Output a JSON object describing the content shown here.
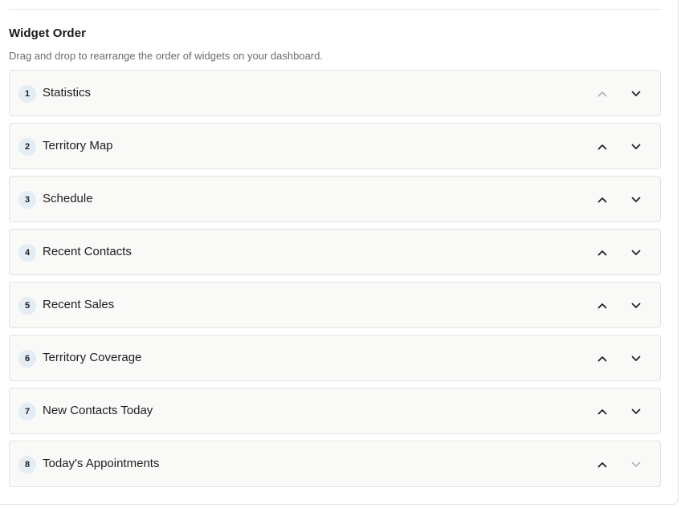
{
  "section": {
    "title": "Widget Order",
    "description": "Drag and drop to rearrange the order of widgets on your dashboard."
  },
  "widgets": [
    {
      "position": "1",
      "label": "Statistics",
      "up_enabled": false,
      "down_enabled": true
    },
    {
      "position": "2",
      "label": "Territory Map",
      "up_enabled": true,
      "down_enabled": true
    },
    {
      "position": "3",
      "label": "Schedule",
      "up_enabled": true,
      "down_enabled": true
    },
    {
      "position": "4",
      "label": "Recent Contacts",
      "up_enabled": true,
      "down_enabled": true
    },
    {
      "position": "5",
      "label": "Recent Sales",
      "up_enabled": true,
      "down_enabled": true
    },
    {
      "position": "6",
      "label": "Territory Coverage",
      "up_enabled": true,
      "down_enabled": true
    },
    {
      "position": "7",
      "label": "New Contacts Today",
      "up_enabled": true,
      "down_enabled": true
    },
    {
      "position": "8",
      "label": "Today's Appointments",
      "up_enabled": true,
      "down_enabled": false
    }
  ],
  "icons": {
    "move_up": "chevron-up-icon",
    "move_down": "chevron-down-icon"
  },
  "colors": {
    "badge_bg": "#e4ecf4",
    "item_bg": "#f9f9f8",
    "item_border": "#e2e2e0",
    "disabled_icon": "#b5b5b5"
  }
}
